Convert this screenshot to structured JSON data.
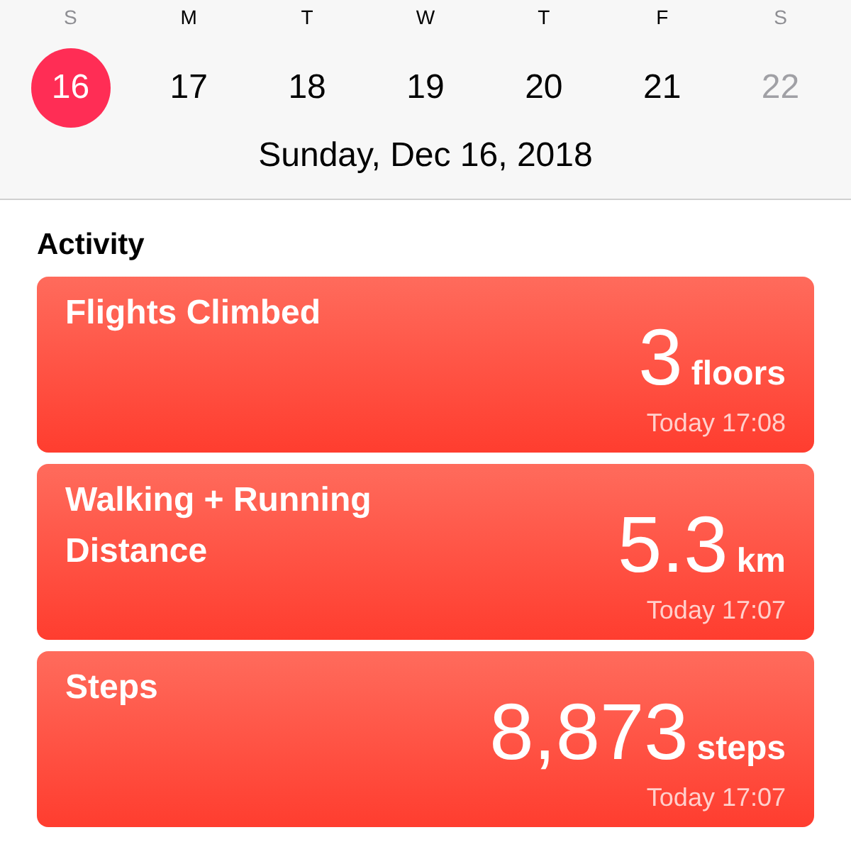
{
  "week": [
    {
      "letter": "S",
      "number": "16",
      "weekend": true,
      "selected": true,
      "future": false
    },
    {
      "letter": "M",
      "number": "17",
      "weekend": false,
      "selected": false,
      "future": false
    },
    {
      "letter": "T",
      "number": "18",
      "weekend": false,
      "selected": false,
      "future": false
    },
    {
      "letter": "W",
      "number": "19",
      "weekend": false,
      "selected": false,
      "future": false
    },
    {
      "letter": "T",
      "number": "20",
      "weekend": false,
      "selected": false,
      "future": false
    },
    {
      "letter": "F",
      "number": "21",
      "weekend": false,
      "selected": false,
      "future": false
    },
    {
      "letter": "S",
      "number": "22",
      "weekend": true,
      "selected": false,
      "future": true
    }
  ],
  "selected_date": "Sunday, Dec 16, 2018",
  "section_title": "Activity",
  "cards": [
    {
      "title": "Flights Climbed",
      "value": "3",
      "unit": "floors",
      "time": "Today 17:08"
    },
    {
      "title": "Walking + Running Distance",
      "value": "5.3",
      "unit": "km",
      "time": "Today 17:07"
    },
    {
      "title": "Steps",
      "value": "8,873",
      "unit": "steps",
      "time": "Today 17:07"
    }
  ]
}
